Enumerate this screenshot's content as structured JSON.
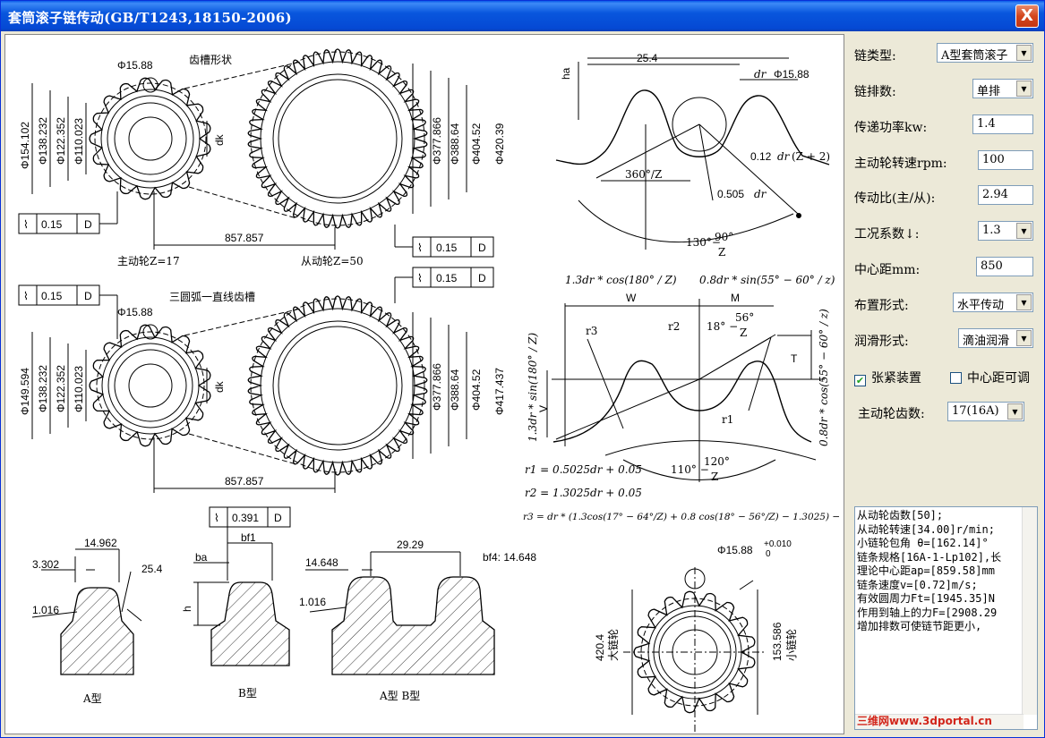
{
  "window": {
    "title": "套筒滚子链传动(GB/T1243,18150-2006)",
    "close_glyph": "X"
  },
  "drawing": {
    "top_section": {
      "label_tooth_shape": "齿槽形状",
      "small_roller": "Φ15.88",
      "small_dims": [
        "Φ154.102",
        "Φ138.232",
        "Φ122.352",
        "Φ110.023"
      ],
      "dk": "dk",
      "large_dims": [
        "Φ377.866",
        "Φ388.64",
        "Φ404.52",
        "Φ420.39"
      ],
      "center_distance": "857.857",
      "tol_small": "0.15",
      "tol_datum": "D",
      "tol_large": "0.15",
      "driver_label": "主动轮Z=17",
      "driven_label": "从动轮Z=50"
    },
    "mid_section": {
      "label_tooth_shape": "三圆弧一直线齿槽",
      "tol_small": "0.15",
      "tol_datum": "D",
      "tol_large": "0.15",
      "small_roller": "Φ15.88",
      "small_dims": [
        "Φ149.594",
        "Φ138.232",
        "Φ122.352",
        "Φ110.023"
      ],
      "dk": "dk",
      "large_dims": [
        "Φ377.866",
        "Φ388.64",
        "Φ404.52",
        "Φ417.437"
      ],
      "center_distance": "857.857"
    },
    "tooth_detail_top": {
      "ha": "ha",
      "pitch": "25.4",
      "dr": "dr",
      "roller": "Φ15.88",
      "angle": "360°/Z",
      "radius": "0.505",
      "formula": "0.12",
      "formula_tail": "(Z + 2)",
      "angle2": "130°−",
      "angle2_num": "90°",
      "angle2_den": "Z"
    },
    "tooth_detail_mid": {
      "f_w": "1.3dr * cos(180° / Z)",
      "f_m": "0.8dr * sin(55° − 60° / z)",
      "W": "W",
      "M": "M",
      "r3": "r3",
      "r2": "r2",
      "r1": "r1",
      "ang18": "18° −",
      "ang18_num": "56°",
      "ang18_den": "Z",
      "T": "T",
      "V": "V",
      "left_formula": "1.3dr * sin(180° / Z)",
      "right_formula": "0.8dr * cos(55° − 60° / z)",
      "ang110": "110° −",
      "ang110_num": "120°",
      "ang110_den": "Z",
      "eq_r1": "r1 = 0.5025dr + 0.05",
      "eq_r2": "r2 = 1.3025dr + 0.05",
      "eq_r3": "r3 = dr * (1.3cos(17° − 64°/Z) + 0.8 cos(18° − 56°/Z) − 1.3025) − 0.05"
    },
    "profiles": {
      "a_width": "14.962",
      "a_left": "3.302",
      "a_right": "25.4",
      "a_chamfer": "1.016",
      "a_label": "A型",
      "b_tol": "0.391",
      "b_datum": "D",
      "bf1": "bf1",
      "ba": "ba",
      "h": "h",
      "b_label": "B型",
      "ab_left": "14.648",
      "ab_pitch": "29.29",
      "ab_chamfer": "1.016",
      "bf4": "bf4: 14.648",
      "ab_label": "A型  B型"
    },
    "sprocket_view": {
      "roller": "Φ15.88",
      "tol_plus": "+0.010",
      "tol_zero": "0",
      "big_dim": "420.4",
      "big_label": "大链轮",
      "small_dim": "153.586",
      "small_label": "小链轮"
    }
  },
  "panel": {
    "chain_type_label": "链类型:",
    "chain_type_value": "A型套筒滚子",
    "rows_label": "链排数:",
    "rows_value": "单排",
    "power_label": "传递功率kw:",
    "power_value": "1.4",
    "speed_label": "主动轮转速rpm:",
    "speed_value": "100",
    "ratio_label": "传动比(主/从):",
    "ratio_value": "2.94",
    "factor_label": "工况系数↓:",
    "factor_value": "1.3",
    "center_label": "中心距mm:",
    "center_value": "850",
    "layout_label": "布置形式:",
    "layout_value": "水平传动",
    "lube_label": "润滑形式:",
    "lube_value": "滴油润滑",
    "tension_label": "张紧装置",
    "tension_checked": "✔",
    "adjust_label": "中心距可调",
    "teeth_label": "主动轮齿数:",
    "teeth_value": "17(16A)",
    "output_lines": [
      "从动轮齿数[50];",
      "从动轮转速[34.00]r/min;",
      "小链轮包角 θ=[162.14]°",
      "链条规格[16A-1-Lp102],长",
      "理论中心距ap=[859.58]mm",
      "链条速度v=[0.72]m/s;",
      "有效圆周力Ft=[1945.35]N",
      "作用到轴上的力F=[2908.29",
      "增加排数可使链节距更小,"
    ],
    "watermark": "三维网www.3dportal.cn"
  },
  "colors": {
    "title_bar": "#0549d4",
    "close": "#d3461d",
    "watermark": "#d2251a"
  }
}
